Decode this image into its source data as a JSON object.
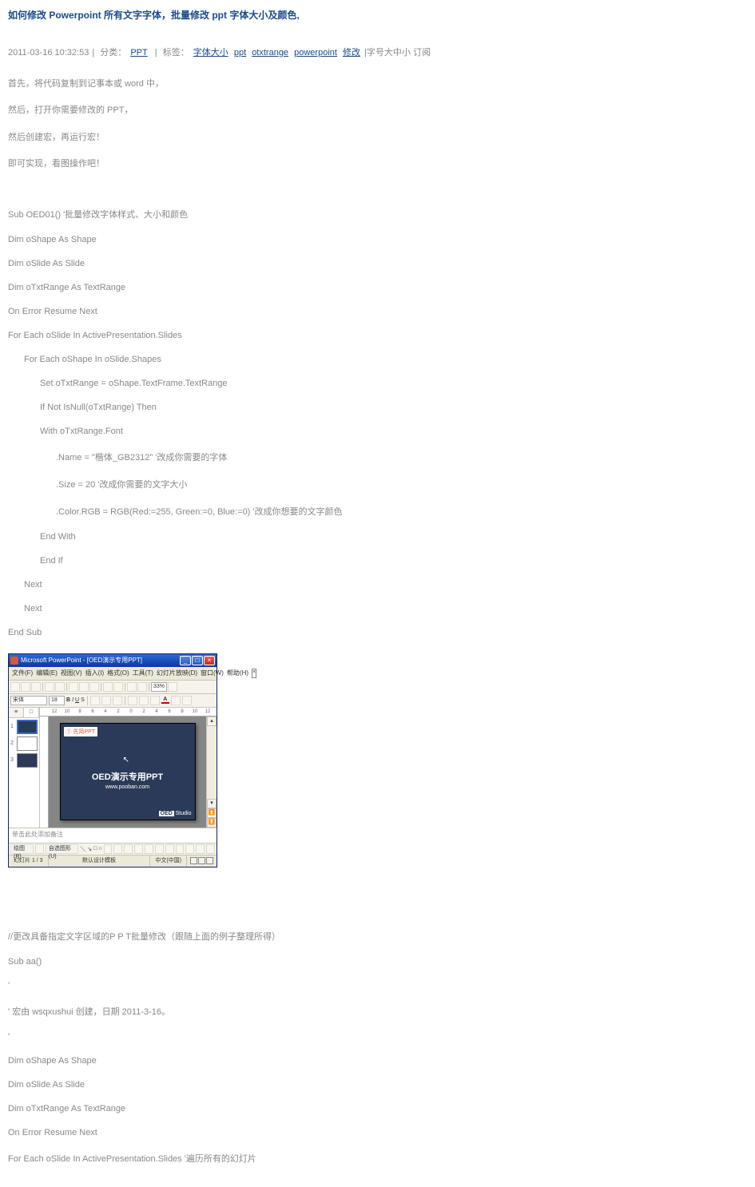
{
  "title": "如何修改 Powerpoint 所有文字字体，批量修改 ppt 字体大小及颜色,",
  "meta": {
    "datetime": "2011-03-16 10:32:53",
    "cat_label": "分类：",
    "cat_link": "PPT",
    "tag_label": "标签：",
    "tags": [
      "字体大小",
      "ppt",
      "otxtrange",
      "powerpoint",
      "修改"
    ],
    "extra": "|字号大中小 订阅"
  },
  "intro": [
    "首先，将代码复制到记事本或 word 中，",
    "然后，打开你需要修改的 PPT，",
    "然后创建宏，再运行宏！",
    "即可实现，看图操作吧！"
  ],
  "code1": [
    {
      "t": "Sub OED01() '批量修改字体样式、大小和颜色",
      "i": 0
    },
    {
      "t": "Dim oShape As Shape",
      "i": 0
    },
    {
      "t": "Dim oSlide As Slide",
      "i": 0
    },
    {
      "t": "Dim oTxtRange As TextRange",
      "i": 0
    },
    {
      "t": "On Error Resume Next",
      "i": 0
    },
    {
      "t": "For Each oSlide In ActivePresentation.Slides",
      "i": 0
    },
    {
      "t": "For Each oShape In oSlide.Shapes",
      "i": 1
    },
    {
      "t": "Set oTxtRange = oShape.TextFrame.TextRange",
      "i": 2
    },
    {
      "t": "If Not IsNull(oTxtRange) Then",
      "i": 2
    },
    {
      "t": "With oTxtRange.Font",
      "i": 2
    },
    {
      "t": ".Name = \"楷体_GB2312\"        '改成你需要的字体",
      "i": 3
    },
    {
      "t": ".Size = 20        '改成你需要的文字大小",
      "i": 3
    },
    {
      "t": ".Color.RGB = RGB(Red:=255, Green:=0, Blue:=0) '改成你想要的文字颜色",
      "i": 3
    },
    {
      "t": "End With",
      "i": 2
    },
    {
      "t": "End If",
      "i": 2
    },
    {
      "t": "Next",
      "i": 1
    },
    {
      "t": "Next",
      "i": 1
    },
    {
      "t": "End Sub",
      "i": 0
    }
  ],
  "ppt": {
    "window_title": "Microsoft PowerPoint - [OED演示专用PPT]",
    "menus": [
      "文件(F)",
      "编辑(E)",
      "视图(V)",
      "插入(I)",
      "格式(O)",
      "工具(T)",
      "幻灯片放映(D)",
      "窗口(W)",
      "帮助(H)"
    ],
    "zoom": "33%",
    "font_name": "宋体",
    "font_size": "18",
    "ruler": [
      "12",
      "10",
      "8",
      "6",
      "4",
      "2",
      "0",
      "2",
      "4",
      "6",
      "8",
      "10",
      "12"
    ],
    "outline_tabs": [
      "≡",
      "□"
    ],
    "thumbs": [
      "1",
      "2",
      "3"
    ],
    "slide_logo": "① 先简PPT",
    "slide_title": "OED演示专用PPT",
    "slide_url": "www.pooban.com",
    "slide_studio_box": "OED",
    "slide_studio_txt": "Studio",
    "notes_placeholder": "单击此处添加备注",
    "draw_label": "绘图(R)",
    "draw_autoshape": "自选图形(U)",
    "status_left": "幻灯片 1 / 3",
    "status_mid": "默认设计模板",
    "status_right": "中文(中国)"
  },
  "comment2": "//更改具备指定文字区域的P P T批量修改（跟随上面的例子整理所得）",
  "code2": [
    {
      "t": "Sub aa()",
      "i": 0
    },
    {
      "t": "'",
      "i": 0
    },
    {
      "t": "' 宏由 wsqxushui 创建，日期 2011-3-16。",
      "i": 0
    },
    {
      "t": "'",
      "i": 0
    },
    {
      "t": "Dim oShape As Shape",
      "i": 0
    },
    {
      "t": "Dim oSlide As Slide",
      "i": 0
    },
    {
      "t": "Dim oTxtRange As TextRange",
      "i": 0
    },
    {
      "t": "On Error Resume Next",
      "i": 0
    },
    {
      "t": "For Each oSlide In ActivePresentation.Slides '遍历所有的幻灯片",
      "i": 0
    }
  ]
}
